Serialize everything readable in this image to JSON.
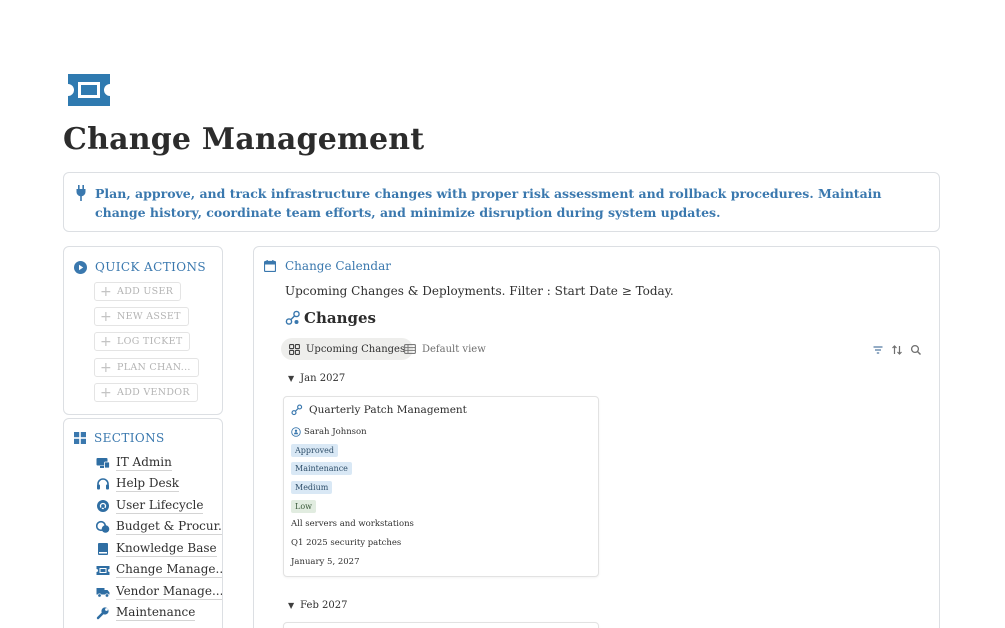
{
  "page": {
    "icon": "ticket-icon",
    "title": "Change Management"
  },
  "callout": {
    "icon": "plug-icon",
    "text": "Plan, approve, and track infrastructure changes with proper risk assessment and rollback procedures. Maintain change history, coordinate team efforts, and minimize disruption during system updates."
  },
  "quick_actions": {
    "heading": "QUICK ACTIONS",
    "icon": "play-circle-icon",
    "buttons": [
      {
        "label": "ADD USER"
      },
      {
        "label": "NEW ASSET"
      },
      {
        "label": "LOG TICKET"
      },
      {
        "label": "PLAN CHAN..."
      },
      {
        "label": "ADD VENDOR"
      }
    ]
  },
  "sections": {
    "heading": "SECTIONS",
    "icon": "grid-icon",
    "items": [
      {
        "label": "IT Admin",
        "icon": "monitor-icon"
      },
      {
        "label": "Help Desk",
        "icon": "headset-icon"
      },
      {
        "label": "User Lifecycle",
        "icon": "cycle-icon"
      },
      {
        "label": "Budget & Procur...",
        "icon": "coins-icon"
      },
      {
        "label": "Knowledge Base",
        "icon": "book-icon"
      },
      {
        "label": "Change Manage...",
        "icon": "ticket-icon"
      },
      {
        "label": "Vendor Manage...",
        "icon": "truck-icon"
      },
      {
        "label": "Maintenance",
        "icon": "wrench-icon"
      }
    ]
  },
  "calendar": {
    "heading": "Change Calendar",
    "icon": "calendar-icon",
    "subtitle": "Upcoming Changes & Deployments. Filter : Start Date ≥ Today.",
    "database_title": "Changes",
    "database_icon": "workflow-icon",
    "views": [
      {
        "label": "Upcoming Changes",
        "icon": "board-icon",
        "active": true
      },
      {
        "label": "Default view",
        "icon": "table-icon",
        "active": false
      }
    ],
    "toolbar": [
      "filter-icon",
      "sort-icon",
      "search-icon"
    ],
    "groups": [
      {
        "label": "Jan 2027",
        "cards": [
          {
            "title": "Quarterly Patch Management",
            "person": "Sarah Johnson",
            "tags": [
              "Approved",
              "Maintenance",
              "Medium",
              "Low"
            ],
            "scope": "All servers and workstations",
            "description": "Q1 2025 security patches",
            "date": "January 5, 2027"
          }
        ]
      },
      {
        "label": "Feb 2027",
        "cards": []
      }
    ]
  },
  "colors": {
    "accent": "#3a78ae",
    "tag_blue": "#d9e8f5",
    "tag_green": "#e1ece0"
  }
}
